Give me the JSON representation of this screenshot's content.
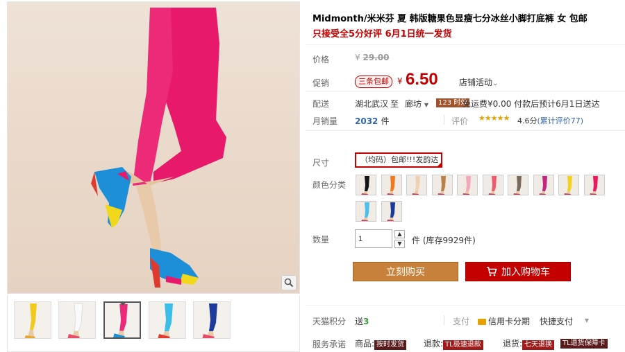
{
  "product": {
    "title": "Midmonth/米米芬 夏 韩版糖果色显瘦七分冰丝小脚打底裤 女 包邮",
    "subtitle": "只接受全5分好评 6月1日统一发货"
  },
  "price": {
    "label": "价格",
    "currency": "¥",
    "original": "29.00"
  },
  "promo": {
    "label": "促销",
    "tag": "三条包邮",
    "currency": "¥",
    "price": "6.50",
    "shop_activity": "店铺活动",
    "shop_activity_arrow": "⌄"
  },
  "shipping": {
    "label": "配送",
    "from": "湖北武汉",
    "to_word": "至",
    "to": "廊坊",
    "dropdown": "▼",
    "badge": "123 时效",
    "details": "免运费¥0.00 付款后预计6月1日送达"
  },
  "sales": {
    "label": "月销量",
    "count": "2032",
    "unit": "件",
    "rating_label": "评价",
    "stars": "★★★★★",
    "score": "4.6分",
    "reviews_prefix": "(累计评价",
    "reviews_count": "77",
    "reviews_suffix": ")"
  },
  "size": {
    "label": "尺寸",
    "selected": "（均码）包邮!!!发韵达"
  },
  "color": {
    "label": "颜色分类",
    "swatches": [
      "#141414",
      "#f07a1e",
      "#efd0b4",
      "#b8814a",
      "#f2a6b8",
      "#f05a6e",
      "#7a6a5c",
      "#c4267e",
      "#f2d21e",
      "#e9185e",
      "#4cc0ea",
      "#1a3a9a"
    ]
  },
  "quantity": {
    "label": "数量",
    "value": "1",
    "up": "▲",
    "down": "▼",
    "unit": "件",
    "stock": "(库存9929件)"
  },
  "actions": {
    "buy_now": "立刻购买",
    "add_to_cart": "加入购物车"
  },
  "tmall_points": {
    "label": "天猫积分",
    "prefix": "送",
    "points": "3",
    "pay_label": "支付",
    "credit_card": "信用卡分期",
    "express_pay": "快捷支付",
    "dropdown": "▾"
  },
  "service": {
    "label": "服务承诺",
    "item1_prefix": "商品:",
    "item1_badge": "按时发货",
    "item2_prefix": "退款:",
    "item2_badge": "TL极速退款",
    "item3_prefix": "退货:",
    "item3_badge": "七天退换",
    "item4_badge": "TL退货保障卡"
  },
  "colors": {
    "accent_red": "#c40000",
    "buy_orange": "#c8813b",
    "link_blue": "#3366aa",
    "background": "#ffffff"
  },
  "thumbnails": [
    "yellow",
    "white",
    "pink",
    "sky-blue",
    "navy"
  ]
}
